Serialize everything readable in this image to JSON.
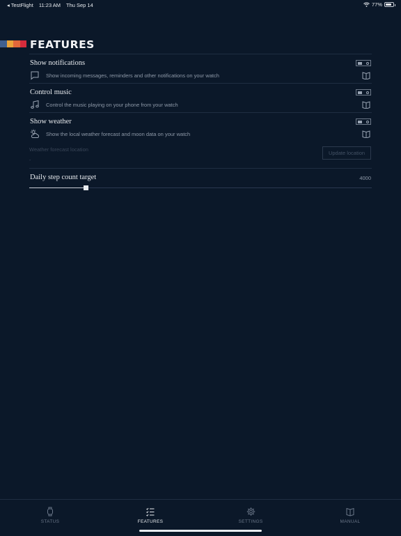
{
  "status_bar": {
    "back_app": "◂ TestFlight",
    "time": "11:23 AM",
    "date": "Thu Sep 14",
    "battery": "77%",
    "battery_level": 0.77
  },
  "header": {
    "title": "FEATURES",
    "stripe_colors": [
      "#3f5f8f",
      "#e8a23a",
      "#e0673a",
      "#d62c3c"
    ]
  },
  "features": [
    {
      "title": "Show notifications",
      "description": "Show incoming messages, reminders and other notifications on your watch",
      "icon": "chat-bubble-icon",
      "enabled": false
    },
    {
      "title": "Control music",
      "description": "Control the music playing on your phone from your watch",
      "icon": "music-note-icon",
      "enabled": false
    },
    {
      "title": "Show weather",
      "description": "Show the local weather forecast and moon data on your watch",
      "icon": "weather-icon",
      "enabled": false
    }
  ],
  "weather_location": {
    "label": "Weather forecast location",
    "value": "-",
    "button_label": "Update location"
  },
  "step_target": {
    "label": "Daily step count target",
    "value": "4000",
    "slider_fraction": 0.165
  },
  "tabs": [
    {
      "label": "STATUS",
      "icon": "watch-icon",
      "active": false
    },
    {
      "label": "FEATURES",
      "icon": "checklist-icon",
      "active": true
    },
    {
      "label": "SETTINGS",
      "icon": "gear-icon",
      "active": false
    },
    {
      "label": "MANUAL",
      "icon": "book-icon",
      "active": false
    }
  ]
}
